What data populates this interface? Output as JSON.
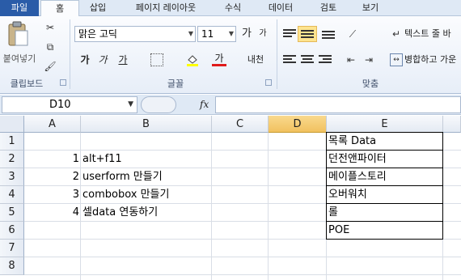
{
  "ribbon": {
    "tabs": [
      "파일",
      "홈",
      "삽입",
      "페이지 레이아웃",
      "수식",
      "데이터",
      "검토",
      "보기"
    ],
    "paste_label": "붙여넣기",
    "clipboard_label": "클립보드",
    "font_label": "글꼴",
    "align_label": "맞춤",
    "font_name": "맑은 고딕",
    "font_size": "11",
    "grow_font": "가",
    "shrink_font": "가",
    "bold": "가",
    "italic": "가",
    "underline": "가",
    "font_color_letter": "가",
    "phonetic": "내천",
    "wrap_text": "텍스트 줄 바",
    "merge_center": "병합하고 가운"
  },
  "formula_bar": {
    "name_box": "D10",
    "fx": "fx",
    "formula": ""
  },
  "sheet": {
    "columns": [
      "A",
      "B",
      "C",
      "D",
      "E"
    ],
    "selected_column": "D",
    "rows": [
      "1",
      "2",
      "3",
      "4",
      "5",
      "6",
      "7",
      "8"
    ],
    "col_a": [
      "",
      "1",
      "2",
      "3",
      "4",
      "",
      "",
      ""
    ],
    "col_b": [
      "",
      "alt+f11",
      "userform 만들기",
      "combobox 만들기",
      "셀data 연동하기",
      "",
      "",
      ""
    ],
    "col_e": [
      "목록 Data",
      "던전앤파이터",
      "메이플스토리",
      "오버워치",
      "롤",
      "POE",
      "",
      ""
    ]
  }
}
